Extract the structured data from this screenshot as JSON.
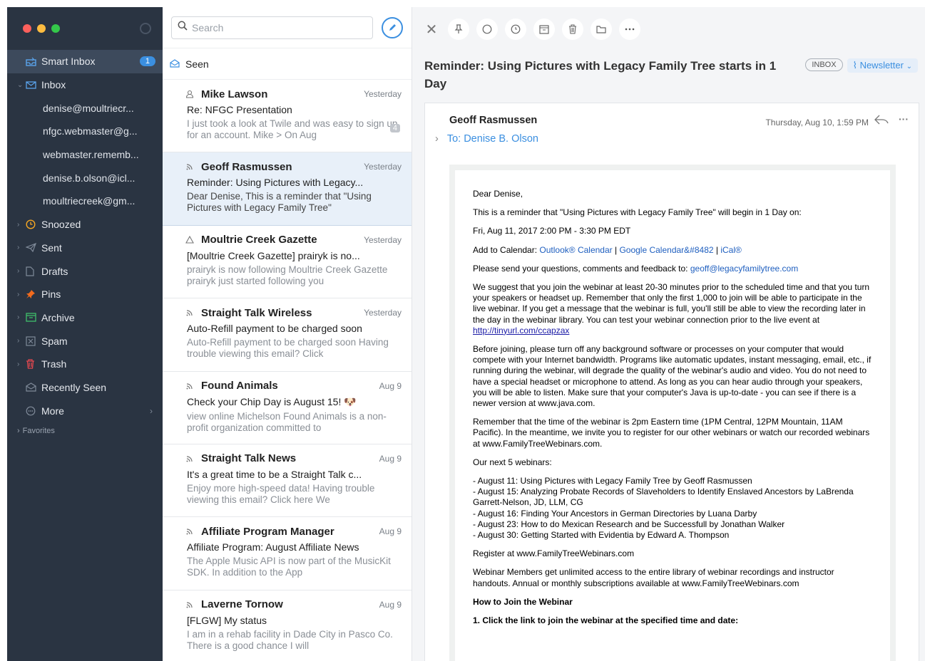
{
  "sidebar": {
    "smart_inbox": "Smart Inbox",
    "smart_inbox_count": "1",
    "inbox": "Inbox",
    "accounts": [
      "denise@moultriecr...",
      "nfgc.webmaster@g...",
      "webmaster.rememb...",
      "denise.b.olson@icl...",
      "moultriecreek@gm..."
    ],
    "snoozed": "Snoozed",
    "sent": "Sent",
    "drafts": "Drafts",
    "pins": "Pins",
    "archive": "Archive",
    "spam": "Spam",
    "trash": "Trash",
    "recently_seen": "Recently Seen",
    "more": "More",
    "favorites": "Favorites",
    "colors": {
      "bg": "#2a3442",
      "accent": "#3b8fe0"
    }
  },
  "list": {
    "search_placeholder": "Search",
    "seen_label": "Seen",
    "messages": [
      {
        "sender": "Mike Lawson",
        "date": "Yesterday",
        "subject": "Re: NFGC Presentation",
        "preview": "I just took a look at Twile and was easy to sign up for an account. Mike > On Aug",
        "count": "4",
        "icon": "person-icon"
      },
      {
        "sender": "Geoff Rasmussen",
        "date": "Yesterday",
        "subject": "Reminder: Using Pictures with Legacy...",
        "preview": "Dear Denise, This is a reminder that \"Using Pictures with Legacy Family Tree\"",
        "icon": "newsletter-icon"
      },
      {
        "sender": "Moultrie Creek Gazette",
        "date": "Yesterday",
        "subject": "[Moultrie Creek Gazette] prairyk is no...",
        "preview": "prairyk is now following Moultrie Creek Gazette prairyk just started following you",
        "icon": "notification-icon"
      },
      {
        "sender": "Straight Talk Wireless",
        "date": "Yesterday",
        "subject": "Auto-Refill payment to be charged soon",
        "preview": "Auto-Refill payment to be charged soon Having trouble viewing this email? Click",
        "icon": "newsletter-icon"
      },
      {
        "sender": "Found Animals",
        "date": "Aug 9",
        "subject": "Check your Chip Day is August 15! 🐶",
        "preview": "view online Michelson Found Animals is a non-profit organization committed to",
        "icon": "newsletter-icon"
      },
      {
        "sender": "Straight Talk News",
        "date": "Aug 9",
        "subject": "It's a great time to be a Straight Talk c...",
        "preview": "Enjoy more high-speed data! Having trouble viewing this email? Click here We",
        "icon": "newsletter-icon"
      },
      {
        "sender": "Affiliate Program Manager",
        "date": "Aug 9",
        "subject": "Affiliate Program: August Affiliate News",
        "preview": "The Apple Music API is now part of the MusicKit SDK. In addition to the App",
        "icon": "newsletter-icon"
      },
      {
        "sender": "Laverne Tornow",
        "date": "Aug 9",
        "subject": "[FLGW] My status",
        "preview": "I am in a rehab facility in Dade City in Pasco Co. There is a good chance I will",
        "icon": "newsletter-icon"
      }
    ]
  },
  "reader": {
    "subject": "Reminder: Using Pictures with Legacy Family Tree starts in 1 Day",
    "tag_inbox": "INBOX",
    "tag_newsletter": "Newsletter",
    "from": "Geoff Rasmussen",
    "to": "To: Denise B. Olson",
    "date": "Thursday, Aug 10, 1:59 PM",
    "body": {
      "greeting": "Dear Denise,",
      "p1": "This is a reminder that \"Using Pictures with Legacy Family Tree\" will begin in 1 Day on:",
      "p2": "Fri, Aug 11, 2017 2:00 PM - 3:30 PM EDT",
      "add_cal_prefix": "Add to Calendar: ",
      "outlook": "Outlook® Calendar",
      "sep1": " | ",
      "google": "Google Calendar&#8482",
      "sep2": " | ",
      "ical": "iCal®",
      "send_prefix": "Please send your questions, comments and feedback to: ",
      "email": "geoff@legacyfamilytree.com",
      "p3a": "We suggest that you join the webinar at least 20-30 minutes prior to the scheduled time and that you turn your speakers or headset up. Remember that only the first 1,000 to join will be able to participate in the live webinar. If you get a message that the webinar is full, you'll still be able to view the recording later in the day in the webinar library. You can test your webinar connection prior to the live event at ",
      "p3link": "http://tinyurl.com/ccapzax",
      "p4": "Before joining, please turn off any background software or processes on your computer that would compete with your Internet bandwidth. Programs like automatic updates, instant messaging, email, etc., if running during the webinar, will degrade the quality of the webinar's audio and video. You do not need to have a special headset or microphone to attend. As long as you can hear audio through your speakers, you will be able to listen. Make sure that your computer's Java is up-to-date - you can see if there is a newer version at www.java.com.",
      "p5": "Remember that the time of the webinar is 2pm Eastern time (1PM Central, 12PM Mountain, 11AM Pacific). In the meantime, we invite you to register for our other webinars or watch our recorded webinars at www.FamilyTreeWebinars.com.",
      "p6": "Our next 5 webinars:",
      "webinars": [
        "- August 11: Using Pictures with Legacy Family Tree by Geoff Rasmussen",
        "- August 15: Analyzing Probate Records of Slaveholders to Identify Enslaved Ancestors by LaBrenda Garrett-Nelson, JD, LLM, CG",
        "- August 16: Finding Your Ancestors in German Directories by Luana Darby",
        "- August 23: How to do Mexican Research and be Successfull by Jonathan Walker",
        "- August 30: Getting Started with Evidentia by Edward A. Thompson"
      ],
      "p7": "Register at www.FamilyTreeWebinars.com",
      "p8": "Webinar Members get unlimited access to the entire library of webinar recordings and instructor handouts. Annual or monthly subscriptions available at www.FamilyTreeWebinars.com",
      "h1": "How to Join the Webinar",
      "h2": "1. Click the link to join the webinar at the specified time and date:"
    }
  }
}
